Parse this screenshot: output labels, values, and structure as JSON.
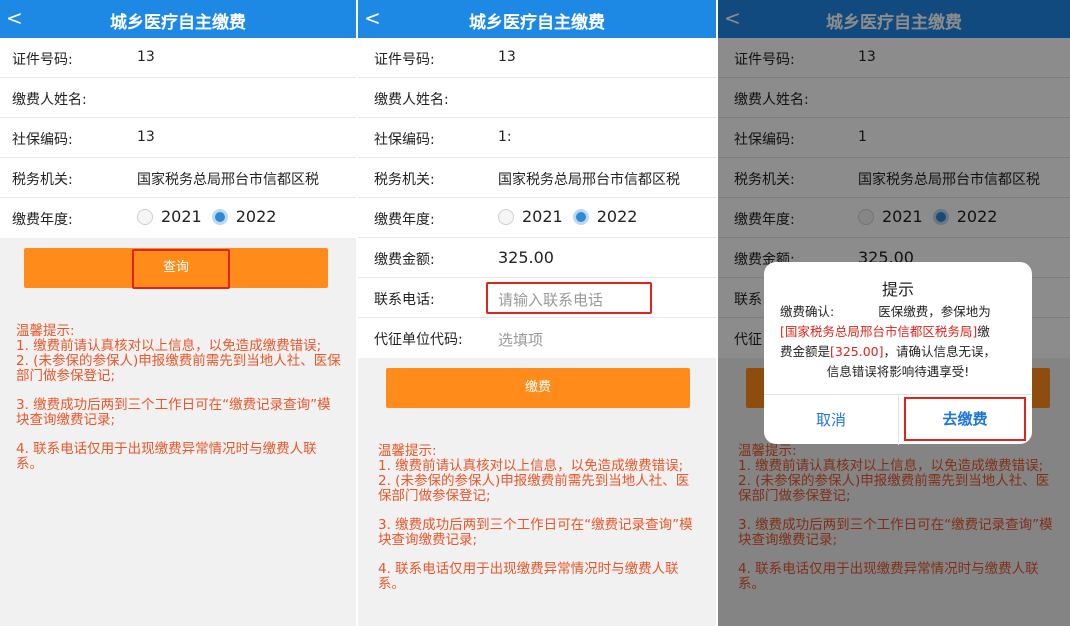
{
  "app": {
    "title": "城乡医疗自主缴费",
    "back_icon": "<"
  },
  "labels": {
    "id_number": "证件号码:",
    "payer_name": "缴费人姓名:",
    "social_code": "社保编码:",
    "tax_office": "税务机关:",
    "year": "缴费年度:",
    "amount": "缴费金额:",
    "phone": "联系电话:",
    "agency_code": "代征单位代码:"
  },
  "screens": [
    {
      "id_number": "13",
      "payer_name": "",
      "social_code": "13",
      "tax_office": "国家税务总局邢台市信都区税",
      "year_options": [
        "2021",
        "2022"
      ],
      "year_selected": "2022",
      "button": "查询"
    },
    {
      "id_number": "13",
      "payer_name": "",
      "social_code": "1:",
      "tax_office": "国家税务总局邢台市信都区税",
      "year_options": [
        "2021",
        "2022"
      ],
      "year_selected": "2022",
      "amount": "325.00",
      "phone_placeholder": "请输入联系电话",
      "agency_placeholder": "选填项",
      "button": "缴费"
    },
    {
      "id_number": "13",
      "payer_name": "",
      "social_code": "1",
      "tax_office": "国家税务总局邢台市信都区税",
      "year_options": [
        "2021",
        "2022"
      ],
      "year_selected": "2022",
      "amount_partial": "325.00",
      "phone_partial": "联系",
      "agency_partial": "代征"
    }
  ],
  "tips": {
    "heading": "温馨提示:",
    "item1": "1. 缴费前请认真核对以上信息，以免造成缴费错误;",
    "item2": "2. (未参保的参保人)申报缴费前需先到当地人社、医保部门做参保登记;",
    "item3": "3. 缴费成功后两到三个工作日可在“缴费记录查询”模块查询缴费记录;",
    "item4": "4. 联系电话仅用于出现缴费异常情况时与缴费人联系。"
  },
  "dialog": {
    "title": "提示",
    "msg_prefix": "缴费确认:",
    "msg_mid": "医保缴费，参保地为",
    "msg_office": "[国家税务总局邢台市信都区税务局]",
    "msg_tail1": "缴",
    "msg_amount_prefix": "费金额是",
    "msg_amount": "[325.00]",
    "msg_tail2": "，请确认信息无误，",
    "msg_warn": "信息错误将影响待遇享受!",
    "cancel": "取消",
    "confirm": "去缴费"
  },
  "colors": {
    "navbar": "#1e88e5",
    "button": "#ff8c1a",
    "tips": "#e8572a",
    "highlight": "#e0241b",
    "link": "#1e78d6"
  }
}
